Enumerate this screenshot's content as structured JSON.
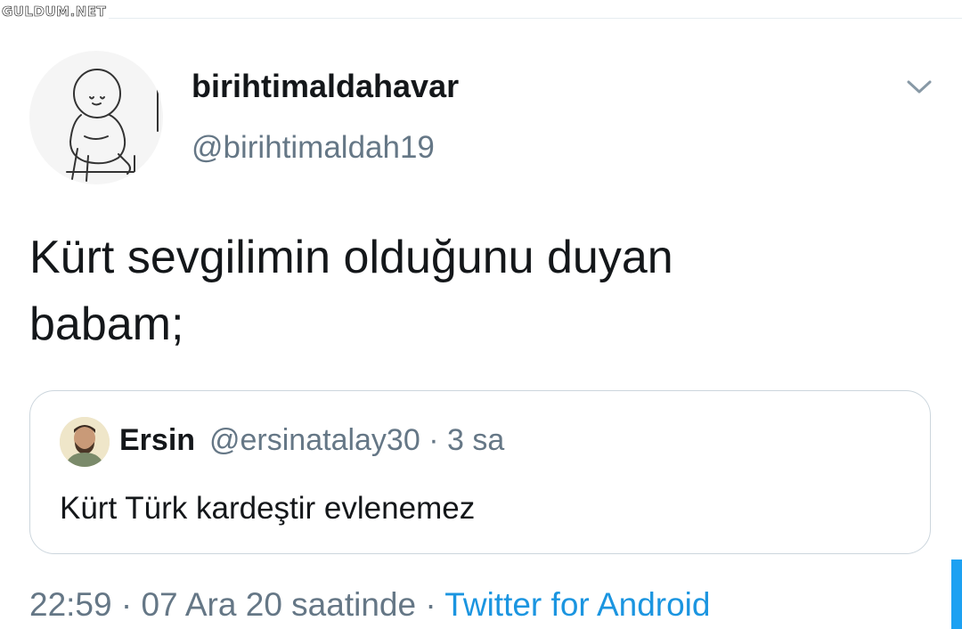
{
  "watermark": "GULDUM.NET",
  "tweet": {
    "display_name": "birihtimaldahavar",
    "handle": "@birihtimaldah19",
    "text_line1": "Kürt sevgilimin olduğunu duyan",
    "text_line2": "babam;",
    "menu_icon": "chevron-down-icon"
  },
  "quoted": {
    "display_name": "Ersin",
    "handle": "@ersinatalay30",
    "separator": "·",
    "time": "3 sa",
    "text": "Kürt Türk kardeştir evlenemez"
  },
  "footer": {
    "time": "22:59",
    "sep1": "·",
    "date": "07 Ara 20 saatinde",
    "sep2": "·",
    "source": "Twitter for Android"
  },
  "colors": {
    "text": "#14171a",
    "secondary": "#657786",
    "link": "#1b95e0",
    "border": "#ccd6dd"
  }
}
